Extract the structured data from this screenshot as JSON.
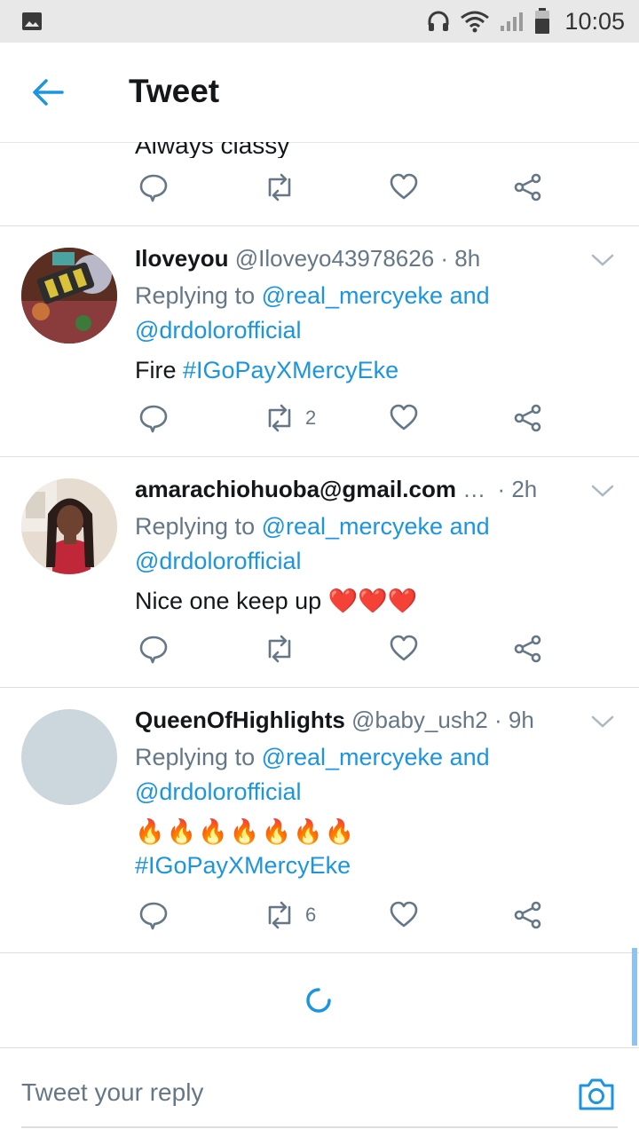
{
  "status_bar": {
    "time": "10:05"
  },
  "header": {
    "title": "Tweet"
  },
  "partial_tweet": {
    "text": "Always classy"
  },
  "tweets": [
    {
      "name": "Iloveyou",
      "handle": "@Iloveyo43978626",
      "time": "· 8h",
      "replying_prefix": "Replying to ",
      "replying_to": "@real_mercyeke and",
      "replying_to_2": "@drdolorofficial",
      "text": "Fire ",
      "hashtag": "#IGoPayXMercyEke",
      "retweets": "2"
    },
    {
      "name": "amarachiohuoba@gmail.com",
      "handle": "…",
      "time": "· 2h",
      "replying_prefix": "Replying to ",
      "replying_to": "@real_mercyeke and",
      "replying_to_2": "@drdolorofficial",
      "text": "Nice one keep up ",
      "emoji": "❤️❤️❤️",
      "retweets": ""
    },
    {
      "name": "QueenOfHighlights",
      "handle": "@baby_ush2",
      "time": "· 9h",
      "replying_prefix": "Replying to ",
      "replying_to": "@real_mercyeke and",
      "replying_to_2": "@drdolorofficial",
      "emoji": "🔥🔥🔥🔥🔥🔥🔥",
      "hashtag": "#IGoPayXMercyEke",
      "retweets": "6"
    }
  ],
  "compose": {
    "placeholder": "Tweet your reply"
  },
  "colors": {
    "accent": "#1b95e0",
    "text": "#14171a",
    "muted": "#657786",
    "heart": "#e0245e"
  }
}
